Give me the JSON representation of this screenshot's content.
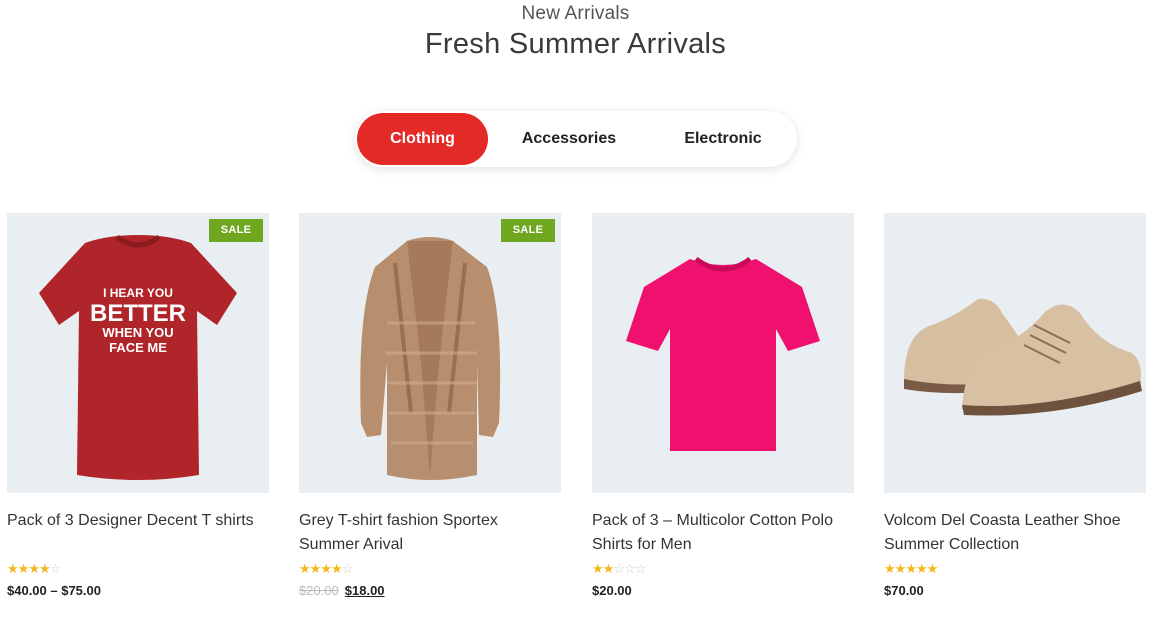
{
  "section": {
    "eyebrow": "New Arrivals",
    "title": "Fresh Summer Arrivals"
  },
  "tabs": [
    {
      "label": "Clothing",
      "active": true
    },
    {
      "label": "Accessories",
      "active": false
    },
    {
      "label": "Electronic",
      "active": false
    }
  ],
  "colors": {
    "accent": "#e42a26",
    "sale_badge": "#6fa720",
    "star": "#f5b81b",
    "thumb_bg": "#e8eef1"
  },
  "products": [
    {
      "name": "Pack of 3 Designer Decent T shirts",
      "sale_badge": "SALE",
      "rating": 4,
      "price": "$40.00 – $75.00",
      "image_icon": "red-tshirt-image",
      "tshirt_text": [
        "I HEAR YOU",
        "BETTER",
        "WHEN YOU",
        "FACE ME"
      ]
    },
    {
      "name": "Grey T-shirt fashion Sportex Summer Arival",
      "sale_badge": "SALE",
      "rating": 4,
      "old_price": "$20.00",
      "price": "$18.00",
      "image_icon": "cardigan-image"
    },
    {
      "name": "Pack of 3 – Multicolor Cotton Polo Shirts for Men",
      "rating": 2,
      "price": "$20.00",
      "image_icon": "pink-tshirt-image"
    },
    {
      "name": "Volcom Del Coasta Leather Shoe Summer Collection",
      "rating": 5,
      "price": "$70.00",
      "image_icon": "shoes-image"
    }
  ]
}
